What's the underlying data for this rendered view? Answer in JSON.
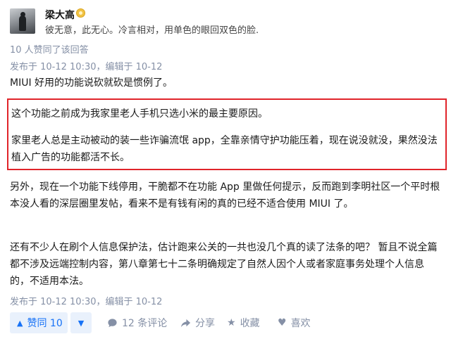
{
  "author": {
    "name": "梁大高",
    "bio": "彼无意，此无心。冷言相对，用单色的眼回双色的脸."
  },
  "upvote_summary": "10 人赞同了该回答",
  "top_meta": "发布于 10-12 10:30，编辑于 10-12",
  "paragraphs": {
    "p1": "MIUI 好用的功能说砍就砍是惯例了。",
    "p2": "这个功能之前成为我家里老人手机只选小米的最主要原因。",
    "p3_line1": "家里老人总是主动被动的装一些诈骗流氓 app，全靠亲情守护功能压着，现在说没就没，果然没法",
    "p3_line2": "植入广告的功能都活不长。",
    "p4_line1": "另外，现在一个功能下线停用，干脆都不在功能 App 里做任何提示，反而跑到李明社区一个平时根",
    "p4_line2": "本没人看的深层圈里发帖，看来不是有钱有闲的真的已经不适合使用 MIUI 了。",
    "p5_line1": "还有不少人在刷个人信息保护法，估计跑来公关的一共也没几个真的读了法条的吧？ 暂且不说全篇",
    "p5_line2": "都不涉及远端控制内容，第八章第七十二条明确规定了自然人因个人或者家庭事务处理个人信息",
    "p5_line3": "的，不适用本法。"
  },
  "bottom_meta": "发布于 10-12 10:30，编辑于 10-12",
  "actions": {
    "upvote_label": "赞同 10",
    "comments_label": "12 条评论",
    "share_label": "分享",
    "favorite_label": "收藏",
    "like_label": "喜欢"
  },
  "colors": {
    "accent": "#1772f6",
    "highlight_border": "#e0242a",
    "meta_text": "#8590a6"
  },
  "icons": {
    "upvote": "triangle-up-icon",
    "downvote": "triangle-down-icon",
    "comment": "comment-bubble-icon",
    "share": "share-arrow-icon",
    "favorite": "star-icon",
    "like": "heart-icon"
  }
}
